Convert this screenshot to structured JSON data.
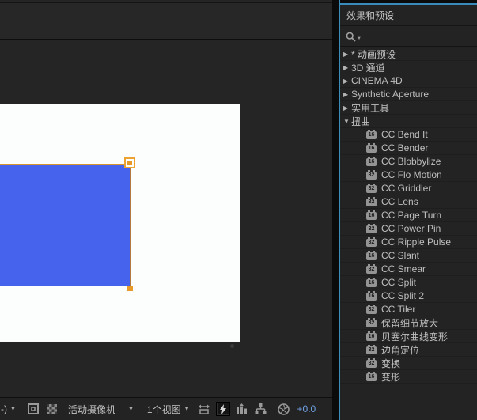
{
  "colors": {
    "panel_accent_blue": "#3a8cba",
    "shape_blue": "#4563ed",
    "selection_orange": "#e89a28",
    "exposure_text_blue": "#6ea0e0",
    "panel_bg": "#232323",
    "viewer_bg": "#252525",
    "canvas_white": "#fcfdfd"
  },
  "icons": {
    "collapsed": "▶",
    "expanded": "▼",
    "caret_down": "▼"
  },
  "viewer": {
    "toolbar": {
      "magnification_partial": "-)",
      "camera_view_label": "活动摄像机",
      "view_layout_label": "1个视图",
      "exposure_value": "+0.0"
    }
  },
  "effects_panel": {
    "title": "效果和预设",
    "search_value": "",
    "search_placeholder": "",
    "items": [
      {
        "type": "category",
        "label": "* 动画预设",
        "expanded": false
      },
      {
        "type": "category",
        "label": "3D 通道",
        "expanded": false
      },
      {
        "type": "category",
        "label": "CINEMA 4D",
        "expanded": false
      },
      {
        "type": "category",
        "label": "Synthetic Aperture",
        "expanded": false
      },
      {
        "type": "category",
        "label": "实用工具",
        "expanded": false
      },
      {
        "type": "category",
        "label": "扭曲",
        "expanded": true
      },
      {
        "type": "effect",
        "label": "CC Bend It",
        "bit": "16"
      },
      {
        "type": "effect",
        "label": "CC Bender",
        "bit": "16"
      },
      {
        "type": "effect",
        "label": "CC Blobbylize",
        "bit": "16"
      },
      {
        "type": "effect",
        "label": "CC Flo Motion",
        "bit": "32"
      },
      {
        "type": "effect",
        "label": "CC Griddler",
        "bit": "32"
      },
      {
        "type": "effect",
        "label": "CC Lens",
        "bit": "32"
      },
      {
        "type": "effect",
        "label": "CC Page Turn",
        "bit": "16"
      },
      {
        "type": "effect",
        "label": "CC Power Pin",
        "bit": "32"
      },
      {
        "type": "effect",
        "label": "CC Ripple Pulse",
        "bit": "32"
      },
      {
        "type": "effect",
        "label": "CC Slant",
        "bit": "16"
      },
      {
        "type": "effect",
        "label": "CC Smear",
        "bit": "32"
      },
      {
        "type": "effect",
        "label": "CC Split",
        "bit": "16"
      },
      {
        "type": "effect",
        "label": "CC Split 2",
        "bit": "16"
      },
      {
        "type": "effect",
        "label": "CC Tiler",
        "bit": "32"
      },
      {
        "type": "effect",
        "label": "保留细节放大",
        "bit": "32"
      },
      {
        "type": "effect",
        "label": "贝塞尔曲线变形",
        "bit": "16"
      },
      {
        "type": "effect",
        "label": "边角定位",
        "bit": "32"
      },
      {
        "type": "effect",
        "label": "变换",
        "bit": "32"
      },
      {
        "type": "effect",
        "label": "变形",
        "bit": "16"
      }
    ]
  }
}
